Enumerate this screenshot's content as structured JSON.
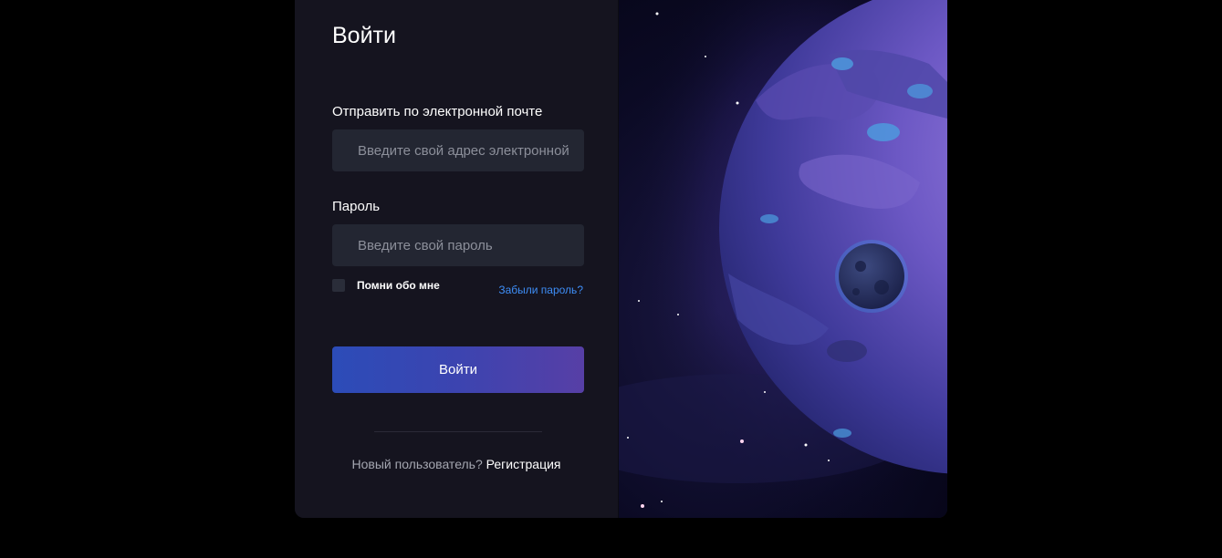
{
  "title": "Войти",
  "email": {
    "label": "Отправить по электронной почте",
    "placeholder": "Введите свой адрес электронной почты"
  },
  "password": {
    "label": "Пароль",
    "placeholder": "Введите свой пароль"
  },
  "remember_label": "Помни обо мне",
  "forgot_label": "Забыли пароль?",
  "submit_label": "Войти",
  "signup": {
    "prompt": "Новый пользователь?",
    "link": "Регистрация"
  },
  "colors": {
    "accent_link": "#3e8ef7",
    "button_start": "#2c4cb8",
    "button_end": "#573fa6",
    "panel_bg": "#15141f",
    "input_bg": "#232632"
  }
}
